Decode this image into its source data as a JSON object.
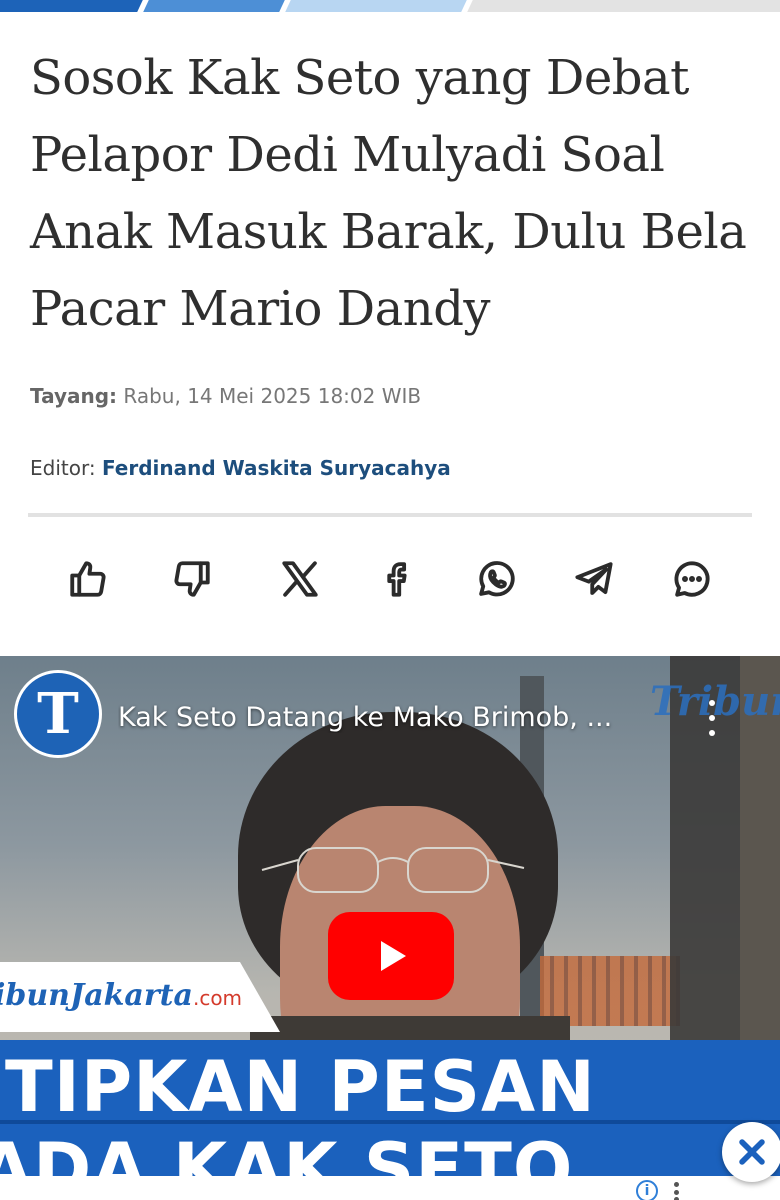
{
  "article": {
    "headline": "Sosok Kak Seto yang Debat Pelapor Dedi Mulyadi Soal Anak Masuk Barak, Dulu Bela Pacar Mario Dandy",
    "published_label": "Tayang:",
    "published_value": "Rabu, 14 Mei 2025 18:02 WIB",
    "editor_label": "Editor:",
    "editor_name": "Ferdinand Waskita Suryacahya"
  },
  "share_bar": {
    "items": [
      {
        "name": "like",
        "icon": "thumbs-up-icon"
      },
      {
        "name": "dislike",
        "icon": "thumbs-down-icon"
      },
      {
        "name": "x",
        "icon": "x-logo-icon"
      },
      {
        "name": "facebook",
        "icon": "facebook-icon"
      },
      {
        "name": "whatsapp",
        "icon": "whatsapp-icon"
      },
      {
        "name": "telegram",
        "icon": "telegram-icon"
      },
      {
        "name": "comment",
        "icon": "comment-icon"
      }
    ]
  },
  "video": {
    "channel_logo_letter": "T",
    "title": "Kak Seto Datang ke Mako Brimob, ...",
    "watermark": "TribunN",
    "brand": "ibunJakarta",
    "brand_suffix": ".com",
    "caption_line1": "ITIPKAN PESAN",
    "caption_line2": "ADA KAK SETO"
  },
  "ad": {
    "info_glyph": "i"
  },
  "colors": {
    "brand_blue": "#1d63b8",
    "editor_link": "#1d4e7d",
    "youtube_red": "#ff0000"
  }
}
